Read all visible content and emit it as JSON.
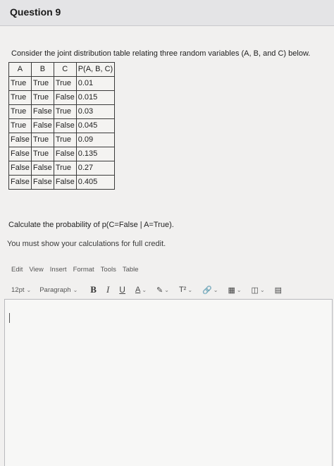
{
  "header": {
    "title": "Question 9"
  },
  "prompt": "Consider the joint distribution table relating three random variables (A, B, and C) below.",
  "table": {
    "headers": [
      "A",
      "B",
      "C",
      "P(A, B, C)"
    ],
    "rows": [
      [
        "True",
        "True",
        "True",
        "0.01"
      ],
      [
        "True",
        "True",
        "False",
        "0.015"
      ],
      [
        "True",
        "False",
        "True",
        "0.03"
      ],
      [
        "True",
        "False",
        "False",
        "0.045"
      ],
      [
        "False",
        "True",
        "True",
        "0.09"
      ],
      [
        "False",
        "True",
        "False",
        "0.135"
      ],
      [
        "False",
        "False",
        "True",
        "0.27"
      ],
      [
        "False",
        "False",
        "False",
        "0.405"
      ]
    ]
  },
  "question": "Calculate the probability of p(C=False | A=True).",
  "note": "You must show your calculations for full credit.",
  "editor": {
    "menu": [
      "Edit",
      "View",
      "Insert",
      "Format",
      "Tools",
      "Table"
    ],
    "font_size": "12pt",
    "block_format": "Paragraph",
    "bold_glyph": "B",
    "italic_glyph": "I",
    "underline_glyph": "U",
    "font_color_glyph": "A",
    "superscript_glyph": "T²"
  }
}
